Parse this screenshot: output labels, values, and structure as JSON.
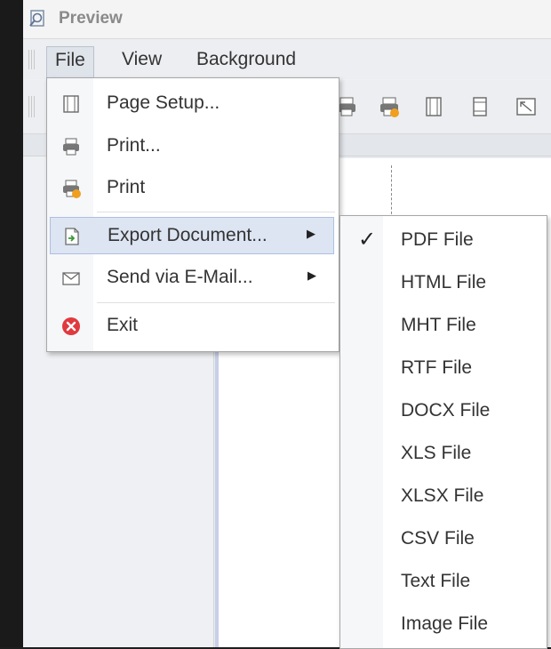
{
  "window": {
    "title": "Preview"
  },
  "menubar": {
    "items": [
      "File",
      "View",
      "Background"
    ]
  },
  "file_menu": {
    "items": [
      {
        "label": "Page Setup...",
        "icon": "page-setup-icon",
        "submenu": false
      },
      {
        "label": "Print...",
        "icon": "printer-icon",
        "submenu": false
      },
      {
        "label": "Print",
        "icon": "quick-print-icon",
        "submenu": false
      },
      {
        "label": "Export Document...",
        "icon": "export-document-icon",
        "submenu": true,
        "highlighted": true
      },
      {
        "label": "Send via E-Mail...",
        "icon": "envelope-icon",
        "submenu": true
      },
      {
        "label": "Exit",
        "icon": "exit-icon",
        "submenu": false
      }
    ],
    "submenu_arrow": "▶"
  },
  "export_submenu": {
    "checkmark": "✓",
    "items": [
      {
        "label": "PDF File",
        "checked": true
      },
      {
        "label": "HTML File",
        "checked": false
      },
      {
        "label": "MHT File",
        "checked": false
      },
      {
        "label": "RTF File",
        "checked": false
      },
      {
        "label": "DOCX File",
        "checked": false
      },
      {
        "label": "XLS File",
        "checked": false
      },
      {
        "label": "XLSX File",
        "checked": false
      },
      {
        "label": "CSV File",
        "checked": false
      },
      {
        "label": "Text File",
        "checked": false
      },
      {
        "label": "Image File",
        "checked": false
      }
    ]
  },
  "colors": {
    "highlight": "#dde5f3",
    "highlight_border": "#aebfe1",
    "exit_red": "#e0393e",
    "print_orange": "#f0a01e"
  }
}
